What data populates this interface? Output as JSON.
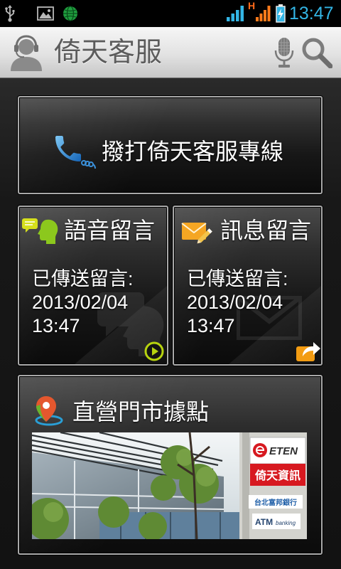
{
  "status_bar": {
    "time": "13:47",
    "data_type_label": "H",
    "icons": [
      "usb-icon",
      "gallery-icon",
      "globe-icon",
      "signal-sim1-icon",
      "signal-sim2-icon",
      "battery-charging-icon"
    ]
  },
  "header": {
    "title": "倚天客服",
    "logo_icon": "headset-person-icon",
    "actions": [
      {
        "icon": "microphone-icon"
      },
      {
        "icon": "search-icon"
      }
    ]
  },
  "call_button": {
    "label": "撥打倚天客服專線",
    "icon": "phone-icon"
  },
  "voice_message": {
    "title": "語音留言",
    "icon": "speech-bubble-icon",
    "status_label": "已傳送留言:",
    "date": "2013/02/04",
    "time": "13:47",
    "action_icon": "play-icon"
  },
  "text_message": {
    "title": "訊息留言",
    "icon": "envelope-pencil-icon",
    "status_label": "已傳送留言:",
    "date": "2013/02/04",
    "time": "13:47",
    "action_icon": "share-icon"
  },
  "stores": {
    "title": "直營門市據點",
    "icon": "map-pin-icon",
    "photo": {
      "brand_logo": "ETEN",
      "store_sign": "倚天資訊",
      "bank_sign": "台北富邦銀行",
      "atm_sign": "ATM",
      "atm_sign_sub": "banking"
    }
  },
  "theme": {
    "accent": "#33b5e5",
    "header_title": "#5c5c5c",
    "panel_text": "#ffffff",
    "play_icon": "#b7d30f",
    "share_icon": "#f39c12",
    "store_sign_red": "#d71920"
  }
}
